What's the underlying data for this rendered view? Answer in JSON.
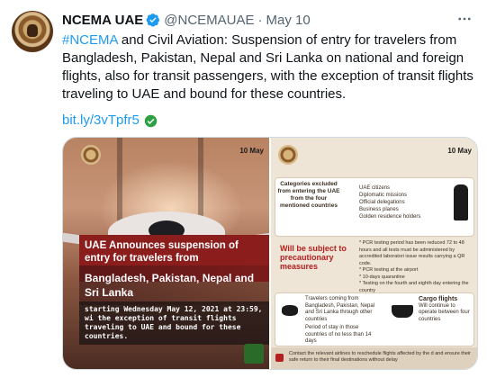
{
  "tweet": {
    "author_name": "NCEMA UAE",
    "handle": "@NCEMAUAE",
    "separator": "·",
    "date": "May 10",
    "more_label": "···",
    "hashtag": "#NCEMA",
    "text": " and Civil Aviation: Suspension of entry for travelers from Bangladesh, Pakistan, Nepal and Sri Lanka on national and foreign flights, also for transit passengers, with the exception of transit flights traveling to UAE and bound for these countries.",
    "link": "bit.ly/3vTpfr5"
  },
  "media": {
    "left": {
      "date": "10 May",
      "headline": "UAE Announces suspension of entry for travelers from",
      "countries": "Bangladesh, Pakistan, Nepal and Sri Lanka",
      "starting": "starting Wednesday May 12, 2021 at 23:59, wi the exception of transit flights traveling to UAE and bound for these countries."
    },
    "right": {
      "date": "10 May",
      "categories": "Categories excluded from entering the UAE from the four mentioned countries",
      "excluded": [
        "UAE citizens",
        "Diplomatic missions",
        "Official delegations",
        "Business planes",
        "Golden residence holders"
      ],
      "will_be": "Will be subject to precautionary measures",
      "requirements": [
        "* PCR testing period has been reduced 72 to 48 hours and all tests must be administered by accredited laboratori issue results carrying a QR code.",
        "* PCR testing at the airport",
        "* 10-days quarantine",
        "* Testing on the fourth and eighth day entering the country"
      ],
      "travelers": "Travelers coming from Bangladesh, Pakistan, Nepal and Sri Lanka through other countries",
      "stay": "Period of stay in those countries of no less than 14 days",
      "cargo_title": "Cargo flights",
      "cargo_text": "Will continue to operate between four countries",
      "footer": "Contact the relevant airlines to reschedule flights affected by the d and ensure their safe return to their final destinations without delay"
    }
  },
  "colors": {
    "link_blue": "#1d9bf0",
    "verified_blue": "#1d9bf0",
    "check_green": "#2ea043",
    "headline_red": "#8b1d1d"
  }
}
